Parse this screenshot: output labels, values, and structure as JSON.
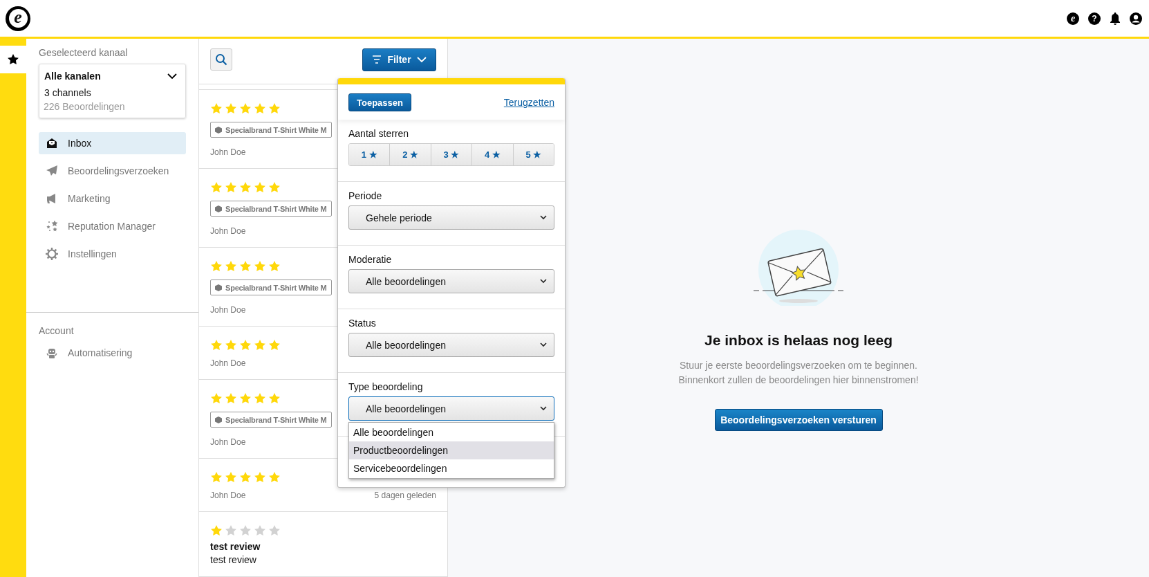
{
  "header": {
    "logo": "e",
    "icons": [
      {
        "kind": "brand",
        "glyph": "e"
      },
      {
        "kind": "help",
        "glyph": "?"
      },
      {
        "kind": "bell"
      },
      {
        "kind": "user"
      }
    ]
  },
  "sidebar": {
    "channel_label": "Geselecteerd kanaal",
    "channel": {
      "name": "Alle kanalen",
      "count": "3 channels",
      "reviews": "226 Beoordelingen"
    },
    "items": [
      {
        "kind": "inbox",
        "label": "Inbox",
        "selected": true
      },
      {
        "kind": "send",
        "label": "Beoordelingsverzoeken",
        "selected": false
      },
      {
        "kind": "megaphone",
        "label": "Marketing",
        "selected": false
      },
      {
        "kind": "stars",
        "label": "Reputation Manager",
        "selected": false
      },
      {
        "kind": "gear",
        "label": "Instellingen",
        "selected": false
      }
    ],
    "account_label": "Account",
    "account_items": [
      {
        "kind": "robot",
        "label": "Automatisering",
        "selected": false
      }
    ]
  },
  "filter_button": {
    "label": "Filter"
  },
  "reviews": [
    {
      "stars": 5,
      "product": "Specialbrand T-Shirt White M",
      "author": "John Doe"
    },
    {
      "stars": 5,
      "product": "Specialbrand T-Shirt White M",
      "author": "John Doe"
    },
    {
      "stars": 5,
      "product": "Specialbrand T-Shirt White M",
      "author": "John Doe"
    },
    {
      "stars": 5,
      "author": "John Doe"
    },
    {
      "stars": 5,
      "product": "Specialbrand T-Shirt White M",
      "author": "John Doe"
    },
    {
      "stars": 5,
      "author": "John Doe",
      "date": "5 dagen geleden"
    },
    {
      "stars": 1,
      "title": "test review",
      "text": "test review"
    }
  ],
  "filter_panel": {
    "apply": "Toepassen",
    "reset": "Terugzetten",
    "star_label": "Aantal sterren",
    "star_options": [
      {
        "label": "1 ★",
        "selected": false
      },
      {
        "label": "2 ★",
        "selected": false
      },
      {
        "label": "3 ★",
        "selected": false
      },
      {
        "label": "4 ★",
        "selected": false
      },
      {
        "label": "5 ★",
        "selected": false
      }
    ],
    "selects": [
      {
        "label": "Periode",
        "value": "Gehele periode",
        "focused": false
      },
      {
        "label": "Moderatie",
        "value": "Alle beoordelingen",
        "focused": false
      },
      {
        "label": "Status",
        "value": "Alle beoordelingen",
        "focused": false
      },
      {
        "label": "Type beoordeling",
        "value": "Alle beoordelingen",
        "focused": true,
        "options": [
          {
            "label": "Alle beoordelingen",
            "highlighted": false
          },
          {
            "label": "Productbeoordelingen",
            "highlighted": true
          },
          {
            "label": "Servicebeoordelingen",
            "highlighted": false
          }
        ]
      }
    ]
  },
  "empty_state": {
    "title": "Je inbox is helaas nog leeg",
    "lines": [
      "Stuur je eerste beoordelingsverzoeken om te beginnen.",
      "Binnenkort zullen de beoordelingen hier binnenstromen!"
    ],
    "button": "Beoordelingsverzoeken versturen"
  }
}
